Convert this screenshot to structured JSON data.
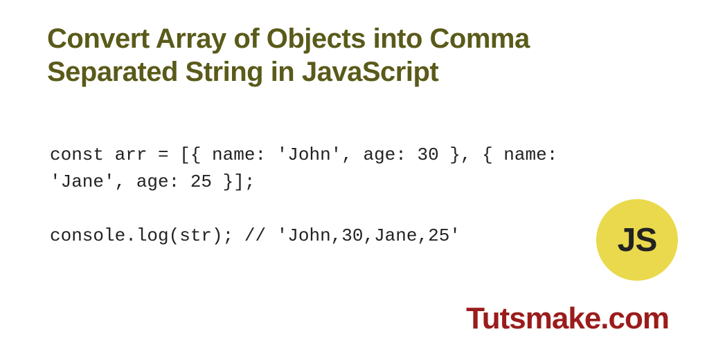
{
  "title": "Convert Array of Objects into Comma Separated String in JavaScript",
  "code": "const arr = [{ name: 'John', age: 30 }, { name: 'Jane', age: 25 }];\n\nconsole.log(str); // 'John,30,Jane,25'",
  "jsBadge": "JS",
  "brand": "Tutsmake.com"
}
